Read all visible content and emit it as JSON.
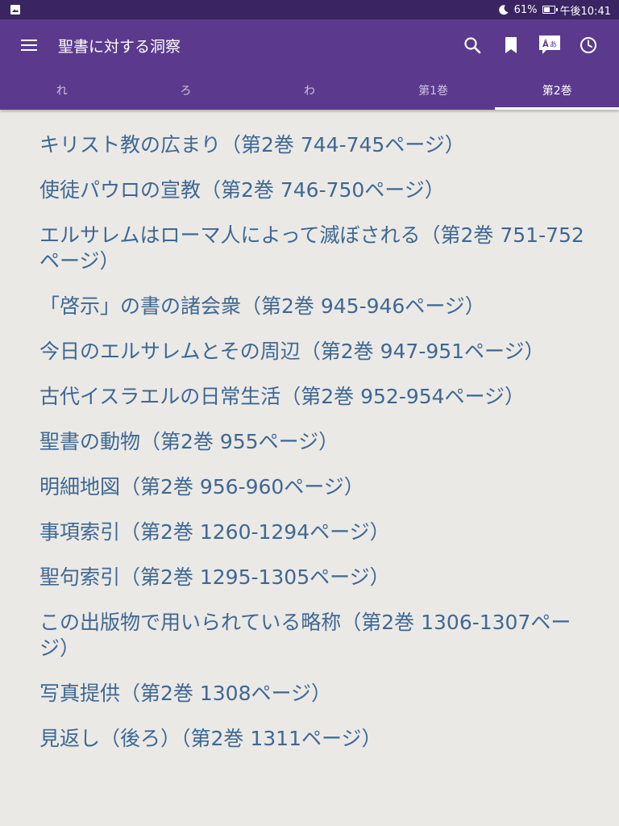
{
  "status_bar": {
    "battery": "61%",
    "battery_level": 0.61,
    "time": "午後10:41"
  },
  "app_bar": {
    "title": "聖書に対する洞察",
    "icons": [
      "menu-icon",
      "search-icon",
      "bookmark-icon",
      "translate-icon",
      "history-icon"
    ]
  },
  "tabs": [
    {
      "label": "れ"
    },
    {
      "label": "ろ"
    },
    {
      "label": "わ"
    },
    {
      "label": "第1巻"
    },
    {
      "label": "第2巻"
    }
  ],
  "active_tab": "第2巻",
  "items": [
    {
      "text": "ージ）"
    },
    {
      "text": "キリスト教の広まり（第2巻 744-745ページ）"
    },
    {
      "text": "使徒パウロの宣教（第2巻 746-750ページ）"
    },
    {
      "text": "エルサレムはローマ人によって滅ぼされる（第2巻 751-752ページ）"
    },
    {
      "text": "「啓示」の書の諸会衆（第2巻 945-946ページ）"
    },
    {
      "text": "今日のエルサレムとその周辺（第2巻 947-951ページ）"
    },
    {
      "text": "古代イスラエルの日常生活（第2巻 952-954ページ）"
    },
    {
      "text": "聖書の動物（第2巻 955ページ）"
    },
    {
      "text": "明細地図（第2巻 956-960ページ）"
    },
    {
      "text": "事項索引（第2巻 1260-1294ページ）"
    },
    {
      "text": "聖句索引（第2巻 1295-1305ページ）"
    },
    {
      "text": "この出版物で用いられている略称（第2巻 1306-1307ページ）"
    },
    {
      "text": "写真提供（第2巻 1308ページ）"
    },
    {
      "text": "見返し（後ろ）（第2巻 1311ページ）"
    }
  ],
  "colors": {
    "status_bar": "#3b2462",
    "app_bar": "#5b3a8e",
    "background": "#ebe9e6",
    "link_text": "#3e6892"
  }
}
